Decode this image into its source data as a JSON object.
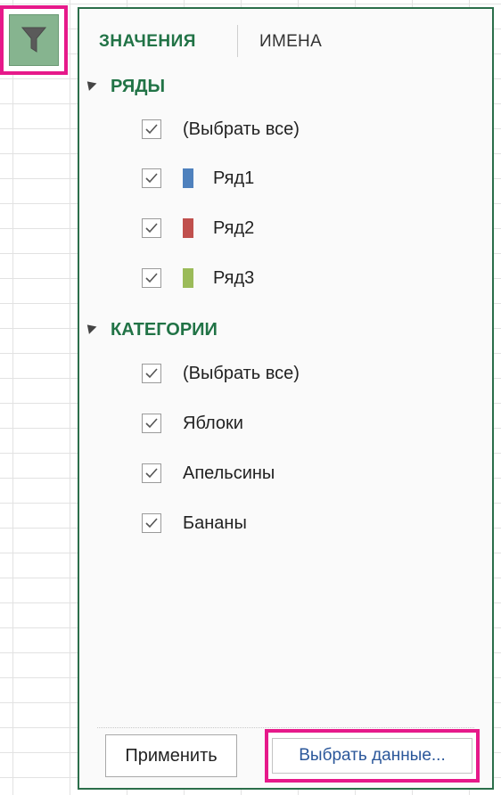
{
  "tabs": {
    "values": "ЗНАЧЕНИЯ",
    "names": "ИМЕНА"
  },
  "series_section": {
    "title": "РЯДЫ",
    "items": [
      {
        "label": "(Выбрать все)",
        "checked": true
      },
      {
        "label": "Ряд1",
        "checked": true,
        "color": "#4f81bd"
      },
      {
        "label": "Ряд2",
        "checked": true,
        "color": "#c0504d"
      },
      {
        "label": "Ряд3",
        "checked": true,
        "color": "#9bbb59"
      }
    ]
  },
  "categories_section": {
    "title": "КАТЕГОРИИ",
    "items": [
      {
        "label": "(Выбрать все)",
        "checked": true
      },
      {
        "label": "Яблоки",
        "checked": true
      },
      {
        "label": "Апельсины",
        "checked": true
      },
      {
        "label": "Бананы",
        "checked": true
      }
    ]
  },
  "buttons": {
    "apply": "Применить",
    "select_data": "Выбрать данные..."
  },
  "colors": {
    "accent": "#217346",
    "highlight": "#e6198a",
    "link": "#2b579a",
    "filter_button": "#86b48f"
  },
  "icons": {
    "filter": "funnel-icon",
    "collapse": "triangle-collapse-icon",
    "check": "checkmark-icon"
  }
}
